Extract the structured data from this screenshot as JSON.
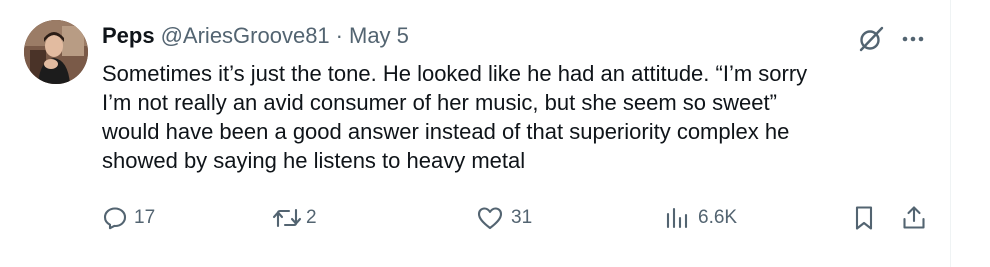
{
  "tweet": {
    "author": {
      "display_name": "Peps",
      "handle": "@AriesGroove81"
    },
    "separator": "·",
    "date": "May 5",
    "text": "Sometimes it’s just the tone. He looked like he had an attitude. “I’m sorry\nI’m not really an avid consumer of her music, but she seem so sweet”\nwould have been a good answer instead of that superiority complex he\nshowed by saying he listens to heavy metal",
    "actions": {
      "reply_count": "17",
      "retweet_count": "2",
      "like_count": "31",
      "view_count": "6.6K"
    },
    "icons": {
      "grok": "grok-icon",
      "more": "more-dots-icon",
      "reply": "reply-icon",
      "retweet": "retweet-icon",
      "like": "heart-icon",
      "views": "views-icon",
      "bookmark": "bookmark-icon",
      "share": "share-icon"
    },
    "colors": {
      "text": "#0f1419",
      "secondary": "#536471"
    }
  }
}
